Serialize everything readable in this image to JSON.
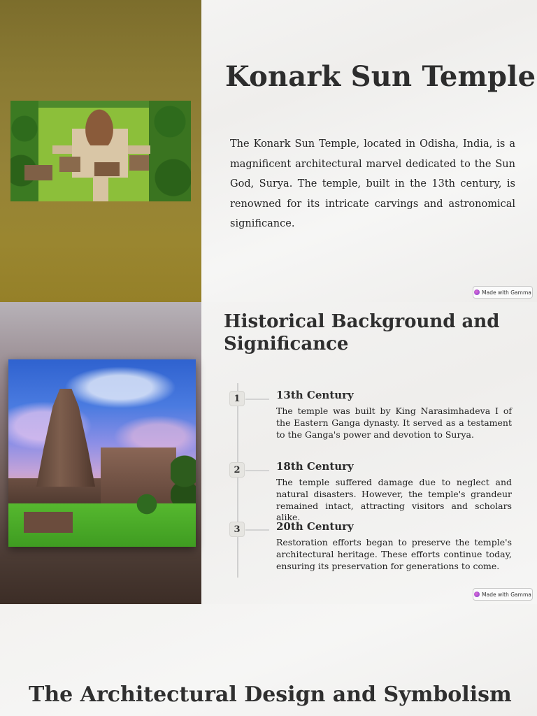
{
  "slide1": {
    "title": "Konark Sun Temple",
    "intro": "The Konark Sun Temple, located in Odisha, India, is a magnificent architectural marvel dedicated to the Sun God, Surya. The temple, built in the 13th century, is renowned for its intricate carvings and astronomical significance.",
    "badge": "Made with Gamma"
  },
  "slide2": {
    "title": "Historical Background and Significance",
    "timeline": [
      {
        "number": "1",
        "heading": "13th Century",
        "body": "The temple was built by King Narasimhadeva I of the Eastern Ganga dynasty. It served as a testament to the Ganga's power and devotion to Surya."
      },
      {
        "number": "2",
        "heading": "18th Century",
        "body": "The temple suffered damage due to neglect and natural disasters. However, the temple's grandeur remained intact, attracting visitors and scholars alike."
      },
      {
        "number": "3",
        "heading": "20th Century",
        "body": "Restoration efforts began to preserve the temple's architectural heritage. These efforts continue today, ensuring its preservation for generations to come."
      }
    ],
    "badge": "Made with Gamma"
  },
  "slide3": {
    "title": "The Architectural Design and Symbolism"
  }
}
